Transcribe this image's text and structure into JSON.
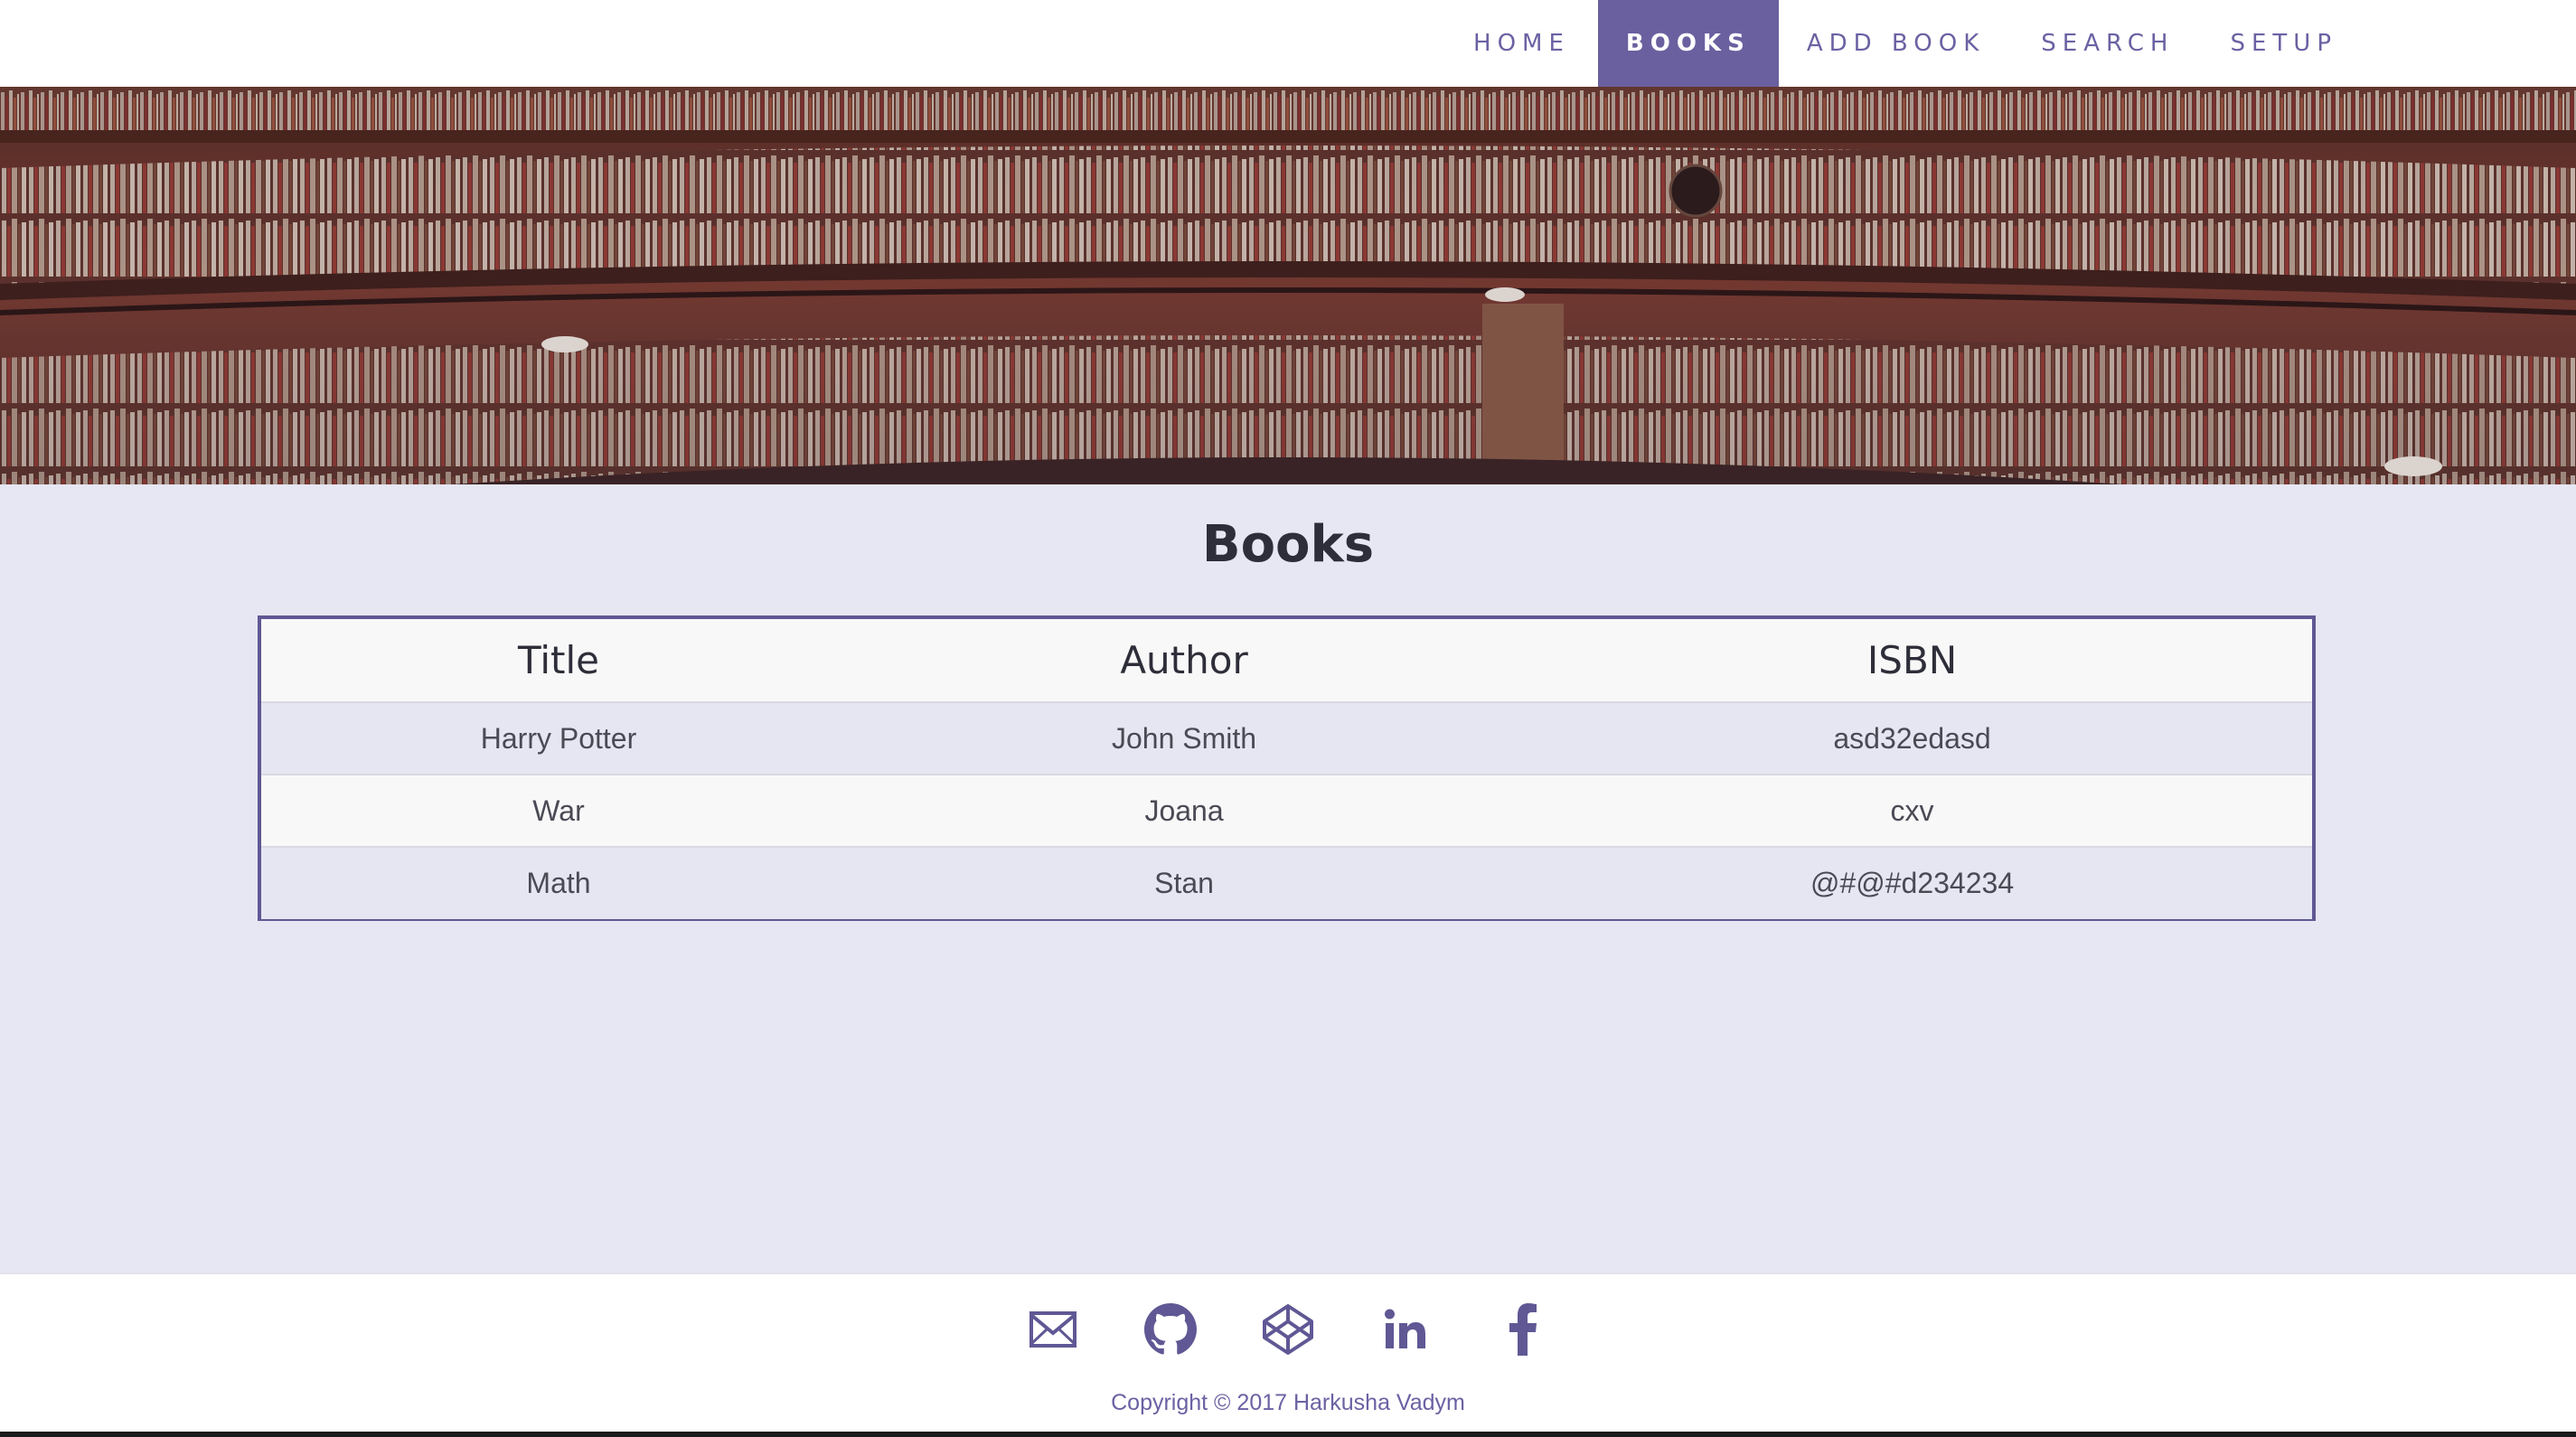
{
  "nav": {
    "items": [
      {
        "label": "HOME",
        "active": false
      },
      {
        "label": "BOOKS",
        "active": true
      },
      {
        "label": "ADD BOOK",
        "active": false
      },
      {
        "label": "SEARCH",
        "active": false
      },
      {
        "label": "SETUP",
        "active": false
      }
    ]
  },
  "page": {
    "title": "Books"
  },
  "table": {
    "headers": [
      "Title",
      "Author",
      "ISBN"
    ],
    "rows": [
      [
        "Harry Potter",
        "John Smith",
        "asd32edasd"
      ],
      [
        "War",
        "Joana",
        "cxv"
      ],
      [
        "Math",
        "Stan",
        "@#@#d234234"
      ]
    ]
  },
  "footer": {
    "icons": [
      "email-icon",
      "github-icon",
      "codepen-icon",
      "linkedin-icon",
      "facebook-icon"
    ],
    "copyright": "Copyright © 2017 Harkusha Vadym"
  },
  "colors": {
    "accent": "#6a609f",
    "background": "#e6e7f3",
    "table_border": "#5f5894"
  }
}
